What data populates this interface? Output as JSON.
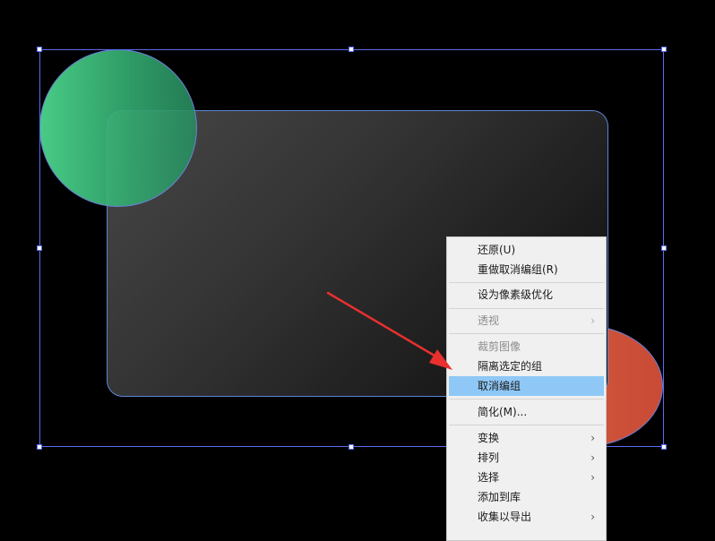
{
  "menu": {
    "items": [
      {
        "label": "还原(U)",
        "state": "normal",
        "submenu": false
      },
      {
        "label": "重做取消编组(R)",
        "state": "normal",
        "submenu": false
      },
      {
        "label": "设为像素级优化",
        "state": "normal",
        "submenu": false
      },
      {
        "label": "透视",
        "state": "disabled",
        "submenu": true
      },
      {
        "label": "裁剪图像",
        "state": "disabled",
        "submenu": false
      },
      {
        "label": "隔离选定的组",
        "state": "normal",
        "submenu": false
      },
      {
        "label": "取消编组",
        "state": "highlighted",
        "submenu": false
      },
      {
        "label": "简化(M)...",
        "state": "normal",
        "submenu": false
      },
      {
        "label": "变换",
        "state": "normal",
        "submenu": true
      },
      {
        "label": "排列",
        "state": "normal",
        "submenu": true
      },
      {
        "label": "选择",
        "state": "normal",
        "submenu": true
      },
      {
        "label": "添加到库",
        "state": "normal",
        "submenu": false
      },
      {
        "label": "收集以导出",
        "state": "normal",
        "submenu": true
      }
    ],
    "submenu_glyph": "›"
  },
  "colors": {
    "canvas": "#000000",
    "selection": "#5a6cf0",
    "highlight": "#8fc8f6",
    "arrow": "#e8302e",
    "green_shape": "#3fbf7f",
    "orange_shape": "#cf5538"
  }
}
